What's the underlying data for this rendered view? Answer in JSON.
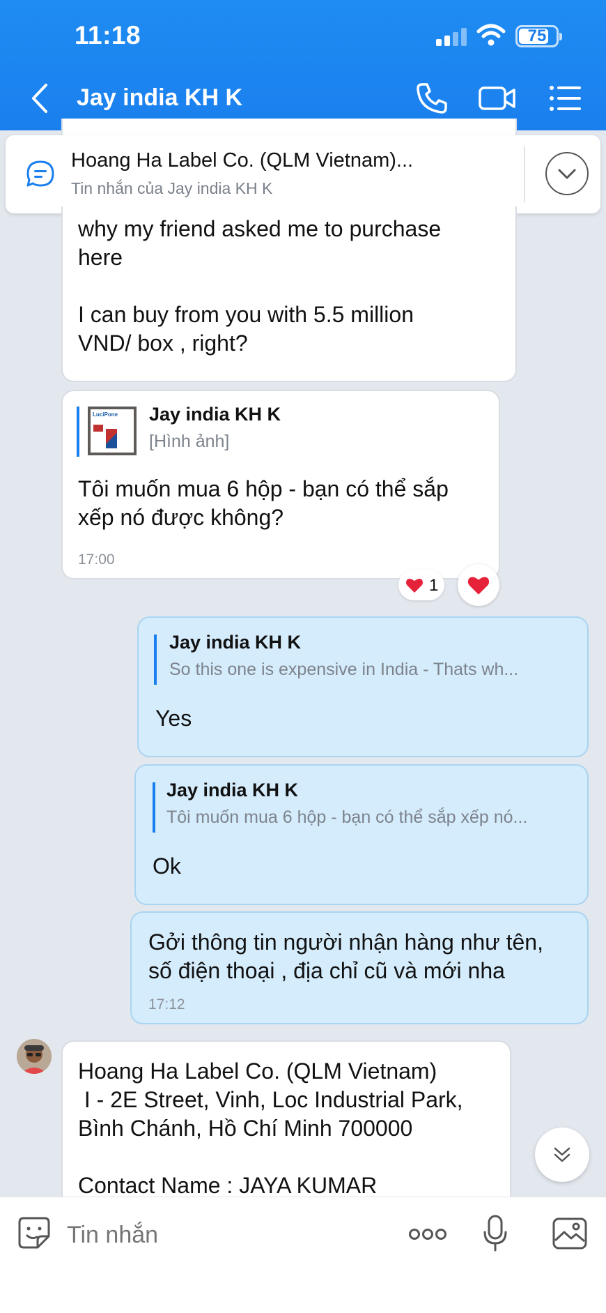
{
  "status_bar": {
    "time": "11:18",
    "battery": "75"
  },
  "header": {
    "title": "Jay india KH K",
    "icons": [
      "back-icon",
      "phone-icon",
      "video-icon",
      "menu-icon"
    ]
  },
  "pinned": {
    "title": "Hoang Ha Label Co. (QLM Vietnam)...",
    "subtitle": "Tin nhắn của Jay india KH K"
  },
  "messages": {
    "m1": {
      "lines": [
        "why my friend asked me to purchase",
        "here",
        "",
        "I can buy from you with 5.5 million",
        "VND/ box , right?"
      ]
    },
    "m2": {
      "quote_name": "Jay india KH K",
      "quote_text": "[Hình ảnh]",
      "thumb_text": "LuciPone",
      "lines": [
        "Tôi muốn mua 6 hộp - bạn có thể sắp",
        "xếp nó được không?"
      ],
      "time": "17:00",
      "reaction_count": "1"
    },
    "m3": {
      "quote_name": "Jay india KH K",
      "quote_text": "So this one is expensive in India - Thats wh...",
      "text": "Yes"
    },
    "m4": {
      "quote_name": "Jay india KH K",
      "quote_text": "Tôi muốn mua 6 hộp - bạn có thể sắp xếp nó...",
      "text": "Ok"
    },
    "m5": {
      "lines": [
        "Gởi thông tin người nhận hàng như tên,",
        "số điện thoại , địa chỉ cũ và mới nha"
      ],
      "time": "17:12"
    },
    "m6": {
      "lines": [
        "Hoang Ha Label Co. (QLM Vietnam)",
        " I - 2E Street, Vinh, Loc Industrial Park,",
        "Bình Chánh, Hồ Chí Minh 700000",
        "",
        "Contact Name : JAYA KUMAR"
      ]
    }
  },
  "composer": {
    "placeholder": "Tin nhắn"
  },
  "colors": {
    "header": "#1a7fee",
    "outgoing_bubble": "#d5ecfc",
    "incoming_bubble": "#ffffff",
    "background": "#e3e7ee",
    "accent": "#1a7fee"
  }
}
